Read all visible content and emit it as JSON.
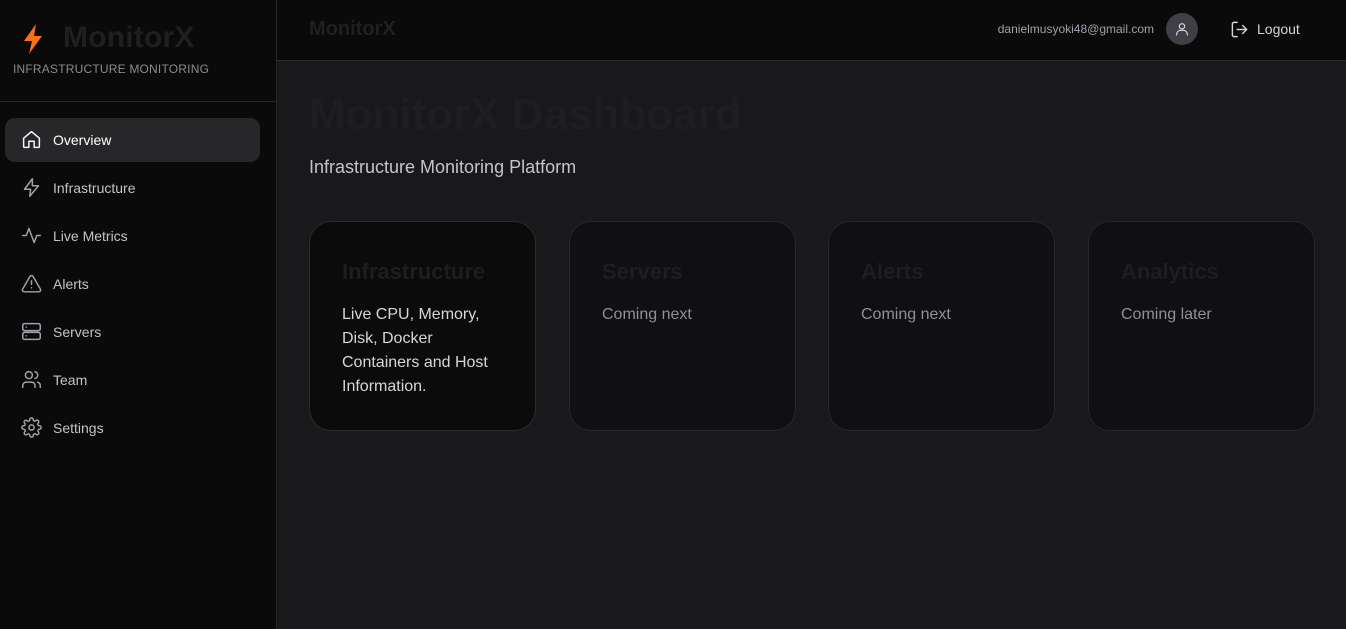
{
  "brand": {
    "name": "MonitorX",
    "subtitle": "INFRASTRUCTURE MONITORING",
    "accent": "#f97316"
  },
  "sidebar": {
    "items": [
      {
        "label": "Overview",
        "icon": "home-icon",
        "active": true
      },
      {
        "label": "Infrastructure",
        "icon": "bolt-icon",
        "active": false
      },
      {
        "label": "Live Metrics",
        "icon": "activity-icon",
        "active": false
      },
      {
        "label": "Alerts",
        "icon": "alert-triangle-icon",
        "active": false
      },
      {
        "label": "Servers",
        "icon": "server-icon",
        "active": false
      },
      {
        "label": "Team",
        "icon": "users-icon",
        "active": false
      },
      {
        "label": "Settings",
        "icon": "gear-icon",
        "active": false
      }
    ]
  },
  "header": {
    "title": "MonitorX",
    "user_email": "danielmusyoki48@gmail.com",
    "logout_label": "Logout"
  },
  "main": {
    "title": "MonitorX Dashboard",
    "subtitle": "Infrastructure Monitoring Platform",
    "cards": [
      {
        "title": "Infrastructure",
        "text": "Live CPU, Memory, Disk, Docker Containers and Host Information."
      },
      {
        "title": "Servers",
        "text": "Coming next"
      },
      {
        "title": "Alerts",
        "text": "Coming next"
      },
      {
        "title": "Analytics",
        "text": "Coming later"
      }
    ]
  }
}
